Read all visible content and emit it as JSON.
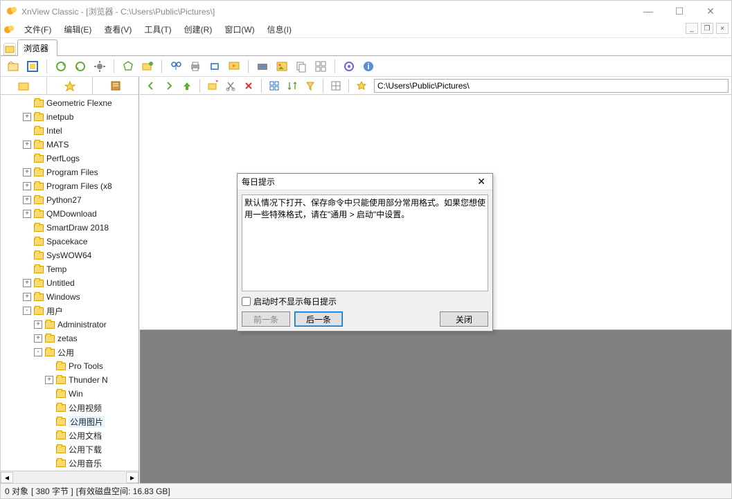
{
  "titlebar": {
    "title": "XnView Classic - [浏览器 - C:\\Users\\Public\\Pictures\\]"
  },
  "menu": {
    "file": "文件(F)",
    "edit": "编辑(E)",
    "view": "查看(V)",
    "tools": "工具(T)",
    "create": "创建(R)",
    "window": "窗口(W)",
    "info": "信息(I)"
  },
  "tab": {
    "browser": "浏览器"
  },
  "address": {
    "path": "C:\\Users\\Public\\Pictures\\"
  },
  "tree": {
    "items": [
      {
        "indent": 2,
        "tw": "",
        "label": "Geometric Flexne"
      },
      {
        "indent": 2,
        "tw": "+",
        "label": "inetpub"
      },
      {
        "indent": 2,
        "tw": "",
        "label": "Intel"
      },
      {
        "indent": 2,
        "tw": "+",
        "label": "MATS"
      },
      {
        "indent": 2,
        "tw": "",
        "label": "PerfLogs"
      },
      {
        "indent": 2,
        "tw": "+",
        "label": "Program Files"
      },
      {
        "indent": 2,
        "tw": "+",
        "label": "Program Files (x8"
      },
      {
        "indent": 2,
        "tw": "+",
        "label": "Python27"
      },
      {
        "indent": 2,
        "tw": "+",
        "label": "QMDownload"
      },
      {
        "indent": 2,
        "tw": "",
        "label": "SmartDraw 2018"
      },
      {
        "indent": 2,
        "tw": "",
        "label": "Spacekace"
      },
      {
        "indent": 2,
        "tw": "",
        "label": "SysWOW64"
      },
      {
        "indent": 2,
        "tw": "",
        "label": "Temp"
      },
      {
        "indent": 2,
        "tw": "+",
        "label": "Untitled"
      },
      {
        "indent": 2,
        "tw": "+",
        "label": "Windows"
      },
      {
        "indent": 2,
        "tw": "-",
        "label": "用户"
      },
      {
        "indent": 3,
        "tw": "+",
        "label": "Administrator"
      },
      {
        "indent": 3,
        "tw": "+",
        "label": "zetas"
      },
      {
        "indent": 3,
        "tw": "-",
        "label": "公用"
      },
      {
        "indent": 4,
        "tw": "",
        "label": "Pro Tools"
      },
      {
        "indent": 4,
        "tw": "+",
        "label": "Thunder N"
      },
      {
        "indent": 4,
        "tw": "",
        "label": "Win"
      },
      {
        "indent": 4,
        "tw": "",
        "label": "公用视频"
      },
      {
        "indent": 4,
        "tw": "",
        "label": "公用图片",
        "selected": true
      },
      {
        "indent": 4,
        "tw": "",
        "label": "公用文档"
      },
      {
        "indent": 4,
        "tw": "",
        "label": "公用下载"
      },
      {
        "indent": 4,
        "tw": "",
        "label": "公用音乐"
      }
    ]
  },
  "dialog": {
    "title": "每日提示",
    "body": "默认情况下打开、保存命令中只能使用部分常用格式。如果您想使用一些特殊格式，请在\"通用 > 启动\"中设置。",
    "checkbox": "启动时不显示每日提示",
    "prev": "前一条",
    "next": "后一条",
    "close": "关闭"
  },
  "status": {
    "objects": "0 对象",
    "bytes": "[ 380 字节 ]",
    "disk": "[有效磁盘空间: 16.83 GB]"
  }
}
